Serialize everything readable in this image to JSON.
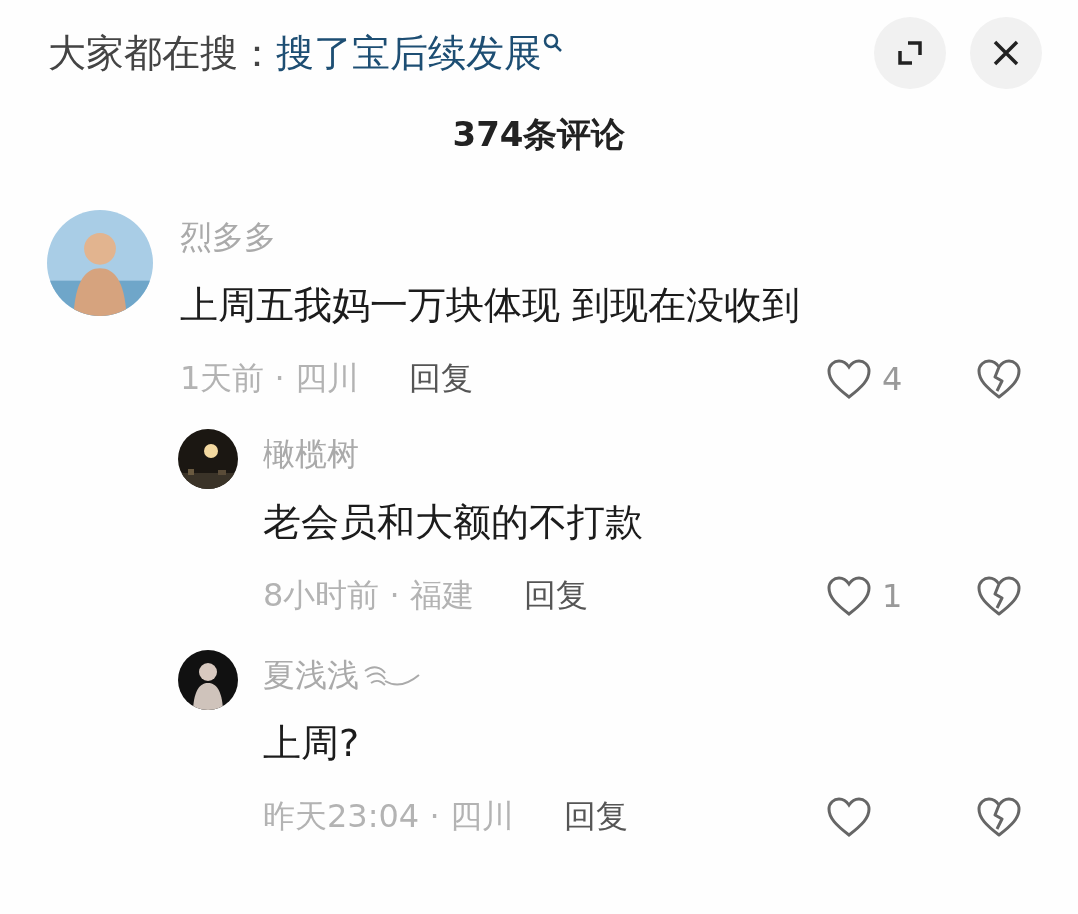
{
  "header": {
    "trending_label": "大家都在搜：",
    "trending_query": "搜了宝后续发展"
  },
  "comment_count": "374条评论",
  "comments": [
    {
      "user": "烈多多",
      "text": "上周五我妈一万块体现 到现在没收到",
      "meta": "1天前 · 四川",
      "reply": "回复",
      "likes": "4",
      "liked": false,
      "children": [
        {
          "user": "橄榄树",
          "text": "老会员和大额的不打款",
          "meta": "8小时前 · 福建",
          "reply": "回复",
          "likes": "1",
          "liked": false
        },
        {
          "user": "夏浅浅",
          "user_badge": true,
          "text": "上周?",
          "meta": "昨天23:04 · 四川",
          "reply": "回复",
          "liked": false
        }
      ]
    }
  ]
}
